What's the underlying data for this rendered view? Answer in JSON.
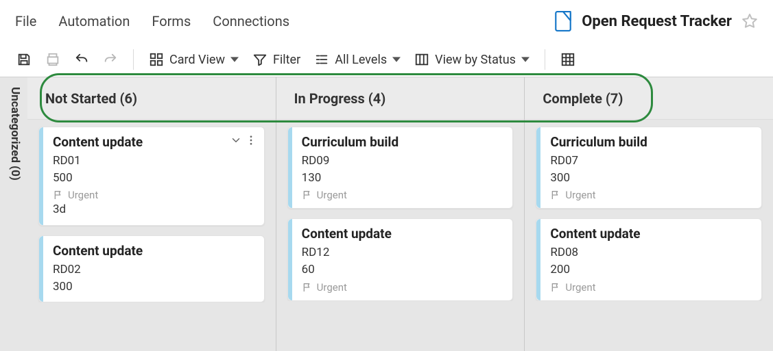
{
  "menu": {
    "file": "File",
    "automation": "Automation",
    "forms": "Forms",
    "connections": "Connections"
  },
  "header": {
    "title": "Open Request Tracker",
    "icon": "sheet-icon"
  },
  "toolbar": {
    "card_view_label": "Card View",
    "filter_label": "Filter",
    "levels_label": "All Levels",
    "view_by_label": "View by Status"
  },
  "board": {
    "side_label": "Uncategorized (0)",
    "columns": [
      {
        "name": "Not Started",
        "count": 6,
        "heading": "Not Started (6)",
        "cards": [
          {
            "title": "Content update",
            "id": "RD01",
            "value": "500",
            "tag": "Urgent",
            "duration": "3d",
            "show_actions": true
          },
          {
            "title": "Content update",
            "id": "RD02",
            "value": "300"
          }
        ]
      },
      {
        "name": "In Progress",
        "count": 4,
        "heading": "In Progress (4)",
        "cards": [
          {
            "title": "Curriculum build",
            "id": "RD09",
            "value": "130",
            "tag": "Urgent"
          },
          {
            "title": "Content update",
            "id": "RD12",
            "value": "60",
            "tag": "Urgent"
          }
        ]
      },
      {
        "name": "Complete",
        "count": 7,
        "heading": "Complete (7)",
        "cards": [
          {
            "title": "Curriculum build",
            "id": "RD07",
            "value": "300",
            "tag": "Urgent"
          },
          {
            "title": "Content update",
            "id": "RD08",
            "value": "200",
            "tag": "Urgent"
          }
        ]
      }
    ]
  }
}
